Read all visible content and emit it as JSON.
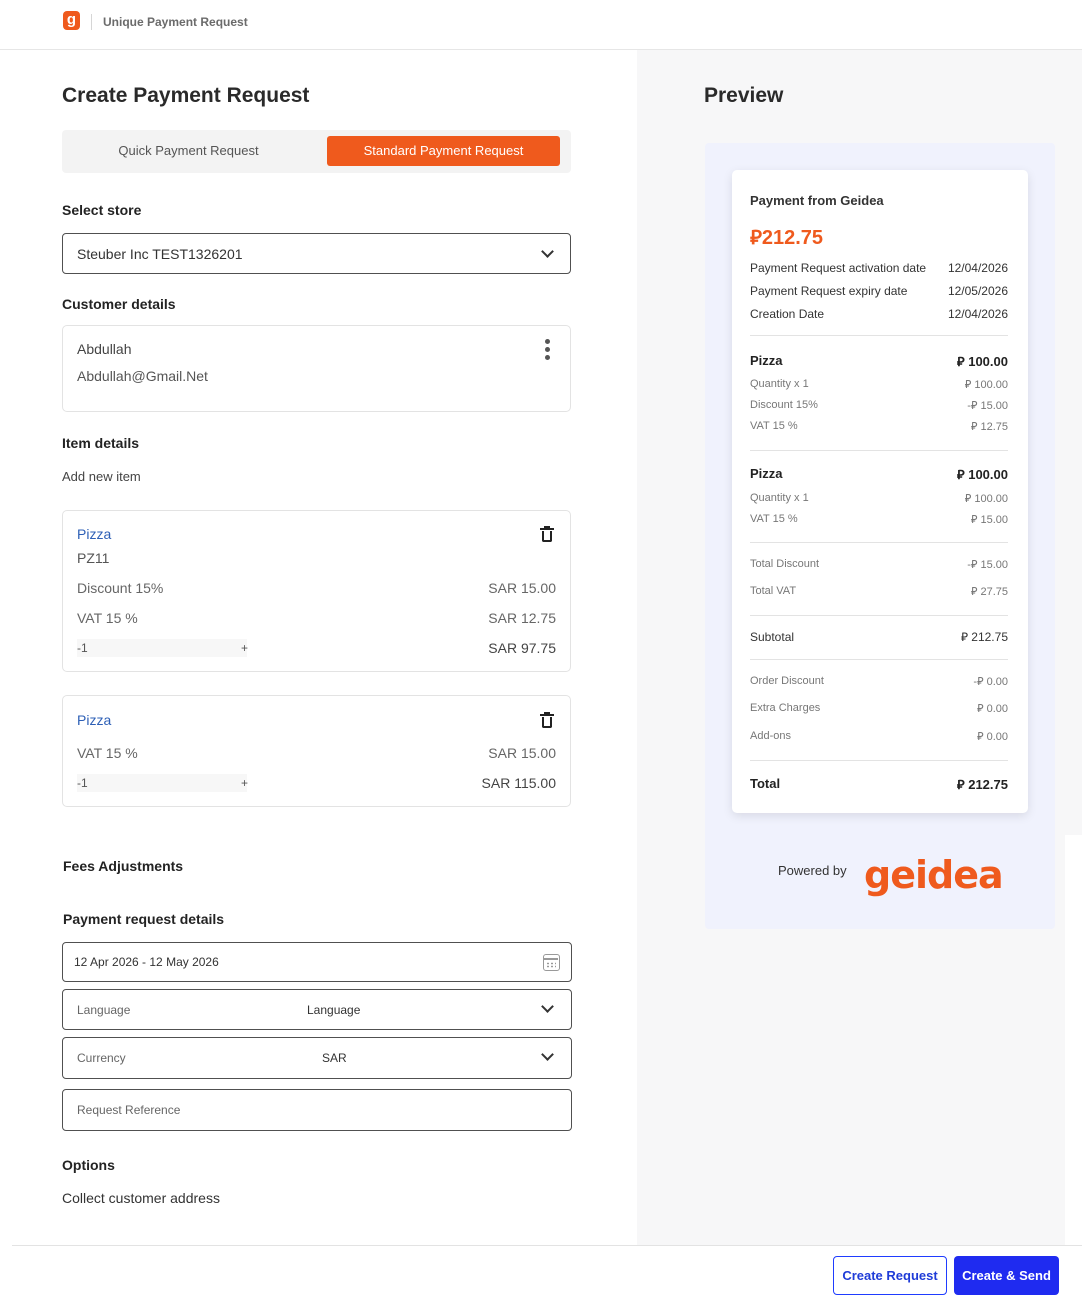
{
  "header": {
    "app_title": "Unique Payment Request",
    "logo_letter": "g"
  },
  "form": {
    "title": "Create Payment Request",
    "tabs": {
      "quick": "Quick Payment Request",
      "standard": "Standard Payment Request"
    },
    "store": {
      "label": "Select store",
      "value": "Steuber Inc TEST1326201"
    },
    "customer": {
      "label": "Customer details",
      "name": "Abdullah",
      "email": "Abdullah@Gmail.Net"
    },
    "items_label": "Item details",
    "add_item": "Add new item",
    "items": [
      {
        "name": "Pizza",
        "sku": "PZ11",
        "discount_label": "Discount 15%",
        "discount_value": "SAR 15.00",
        "vat_label": "VAT 15 %",
        "vat_value": "SAR 12.75",
        "minus": "-1",
        "plus": "+",
        "total": "SAR 97.75"
      },
      {
        "name": "Pizza",
        "vat_label": "VAT 15 %",
        "vat_value": "SAR 15.00",
        "minus": "-1",
        "plus": "+",
        "total": "SAR 115.00"
      }
    ],
    "fees_label": "Fees Adjustments",
    "details_label": "Payment request details",
    "date_range": "12 Apr 2026 - 12 May 2026",
    "language": {
      "label": "Language",
      "value": "Language"
    },
    "currency": {
      "label": "Currency",
      "value": "SAR"
    },
    "reference_placeholder": "Request Reference",
    "options_label": "Options",
    "collect_address": "Collect customer address"
  },
  "preview": {
    "title": "Preview",
    "payment_from": "Payment from Geidea",
    "amount": "⃁212.75",
    "meta": [
      {
        "label": "Payment Request activation date",
        "value": "12/04/2026"
      },
      {
        "label": "Payment Request expiry date",
        "value": "12/05/2026"
      },
      {
        "label": "Creation Date",
        "value": "12/04/2026"
      }
    ],
    "lines": [
      {
        "name": "Pizza",
        "price": "⃁ 100.00",
        "rows": [
          {
            "label": "Quantity x 1",
            "value": "⃁ 100.00"
          },
          {
            "label": "Discount 15%",
            "value": "-⃁ 15.00"
          },
          {
            "label": "VAT 15 %",
            "value": "⃁ 12.75"
          }
        ]
      },
      {
        "name": "Pizza",
        "price": "⃁ 100.00",
        "rows": [
          {
            "label": "Quantity x 1",
            "value": "⃁ 100.00"
          },
          {
            "label": "VAT 15 %",
            "value": "⃁ 15.00"
          }
        ]
      }
    ],
    "total_discount": {
      "label": "Total Discount",
      "value": "-⃁ 15.00"
    },
    "total_vat": {
      "label": "Total VAT",
      "value": "⃁ 27.75"
    },
    "subtotal": {
      "label": "Subtotal",
      "value": "⃁ 212.75"
    },
    "order_discount": {
      "label": "Order Discount",
      "value": "-⃁ 0.00"
    },
    "extra_charges": {
      "label": "Extra Charges",
      "value": "⃁ 0.00"
    },
    "addons": {
      "label": "Add-ons",
      "value": "⃁ 0.00"
    },
    "total": {
      "label": "Total",
      "value": "⃁ 212.75"
    },
    "powered_by": "Powered by",
    "brand": "geidea"
  },
  "footer": {
    "create_request": "Create Request",
    "create_send": "Create & Send"
  },
  "colors": {
    "accent": "#ef5a1d",
    "primary_button": "#1f2bf0",
    "link": "#2d5fb6"
  }
}
